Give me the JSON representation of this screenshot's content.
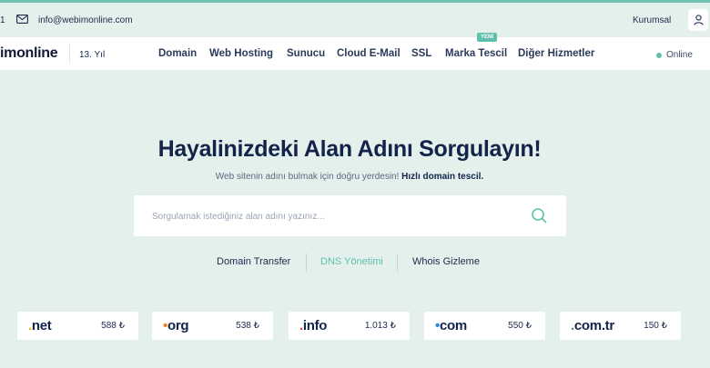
{
  "topbar": {
    "phone_fragment": "1",
    "email": "info@webimonline.com",
    "corporate": "Kurumsal"
  },
  "nav": {
    "logo": "imonline",
    "years": "13. Yıl",
    "items": [
      "Domain",
      "Web Hosting",
      "Sunucu",
      "Cloud E-Mail",
      "SSL",
      "Marka Tescil",
      "Diğer Hizmetler"
    ],
    "new_badge": "YENİ",
    "status": "Online"
  },
  "hero": {
    "title": "Hayalinizdeki Alan Adını Sorgulayın!",
    "subtitle": "Web sitenin adını bulmak için doğru yerdesin!",
    "subtitle_bold": "Hızlı domain tescil."
  },
  "search": {
    "placeholder": "Sorgulamak istediğiniz alan adını yazınız..."
  },
  "links": [
    "Domain Transfer",
    "DNS Yönetimi",
    "Whois Gizleme"
  ],
  "tlds": [
    {
      "dot": ".",
      "name": "net",
      "price": "588 ₺",
      "dot_color": "#f2b705"
    },
    {
      "dot": "•",
      "name": "org",
      "price": "538 ₺",
      "dot_color": "#f58220"
    },
    {
      "dot": ".",
      "name": "info",
      "price": "1.013 ₺",
      "dot_color": "#e53935"
    },
    {
      "dot": "•",
      "name": "com",
      "price": "550 ₺",
      "dot_color": "#1e88e5"
    },
    {
      "dot": ".",
      "name": "com.tr",
      "price": "150 ₺",
      "dot_color": "#43a047"
    }
  ],
  "colors": {
    "accent": "#5fbfad",
    "background": "#e4f0ec",
    "text_dark": "#13244a"
  }
}
